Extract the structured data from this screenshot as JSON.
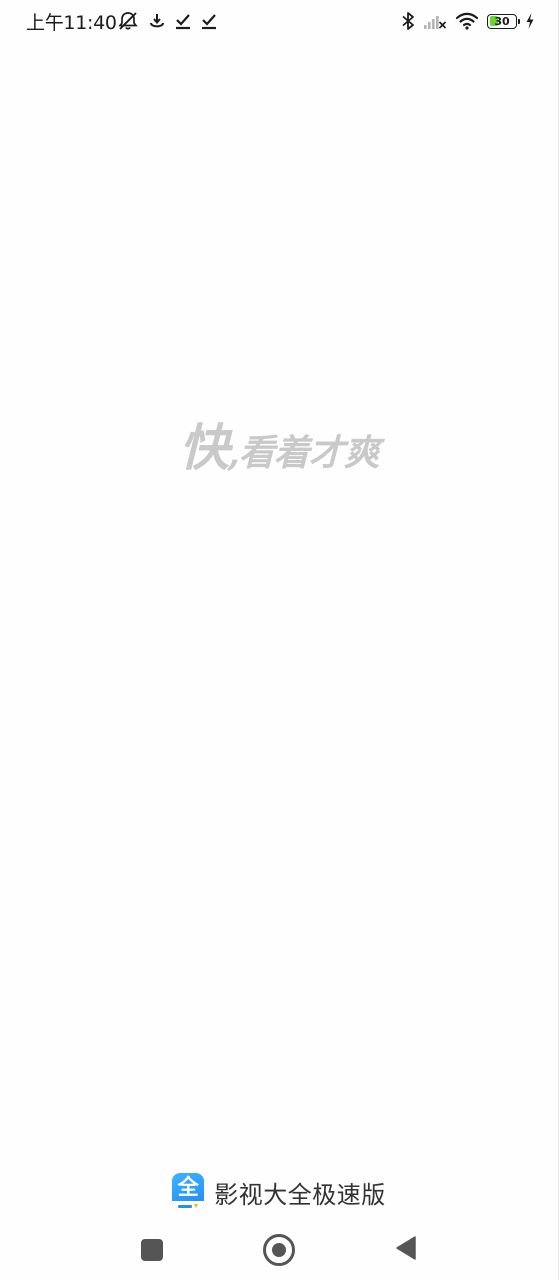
{
  "status_bar": {
    "time": "上午11:40",
    "left_icons": [
      "mute-alarm-icon",
      "download-icon",
      "check-icon",
      "check-icon"
    ],
    "right_icons": [
      "bluetooth-icon",
      "signal-off-icon",
      "wifi-icon",
      "battery-icon",
      "charging-icon"
    ],
    "battery_level": "30",
    "battery_fraction": 0.3,
    "battery_color": "#6cd13b"
  },
  "splash": {
    "slogan_big": "快",
    "slogan_rest": ",看着才爽",
    "slogan_color": "#c9c9c9"
  },
  "brand": {
    "logo_char": "全",
    "name": "影视大全极速版",
    "logo_color": "#1f86f0"
  },
  "nav_bar": {
    "buttons": [
      "recents-square-icon",
      "home-circle-icon",
      "back-triangle-icon"
    ]
  }
}
